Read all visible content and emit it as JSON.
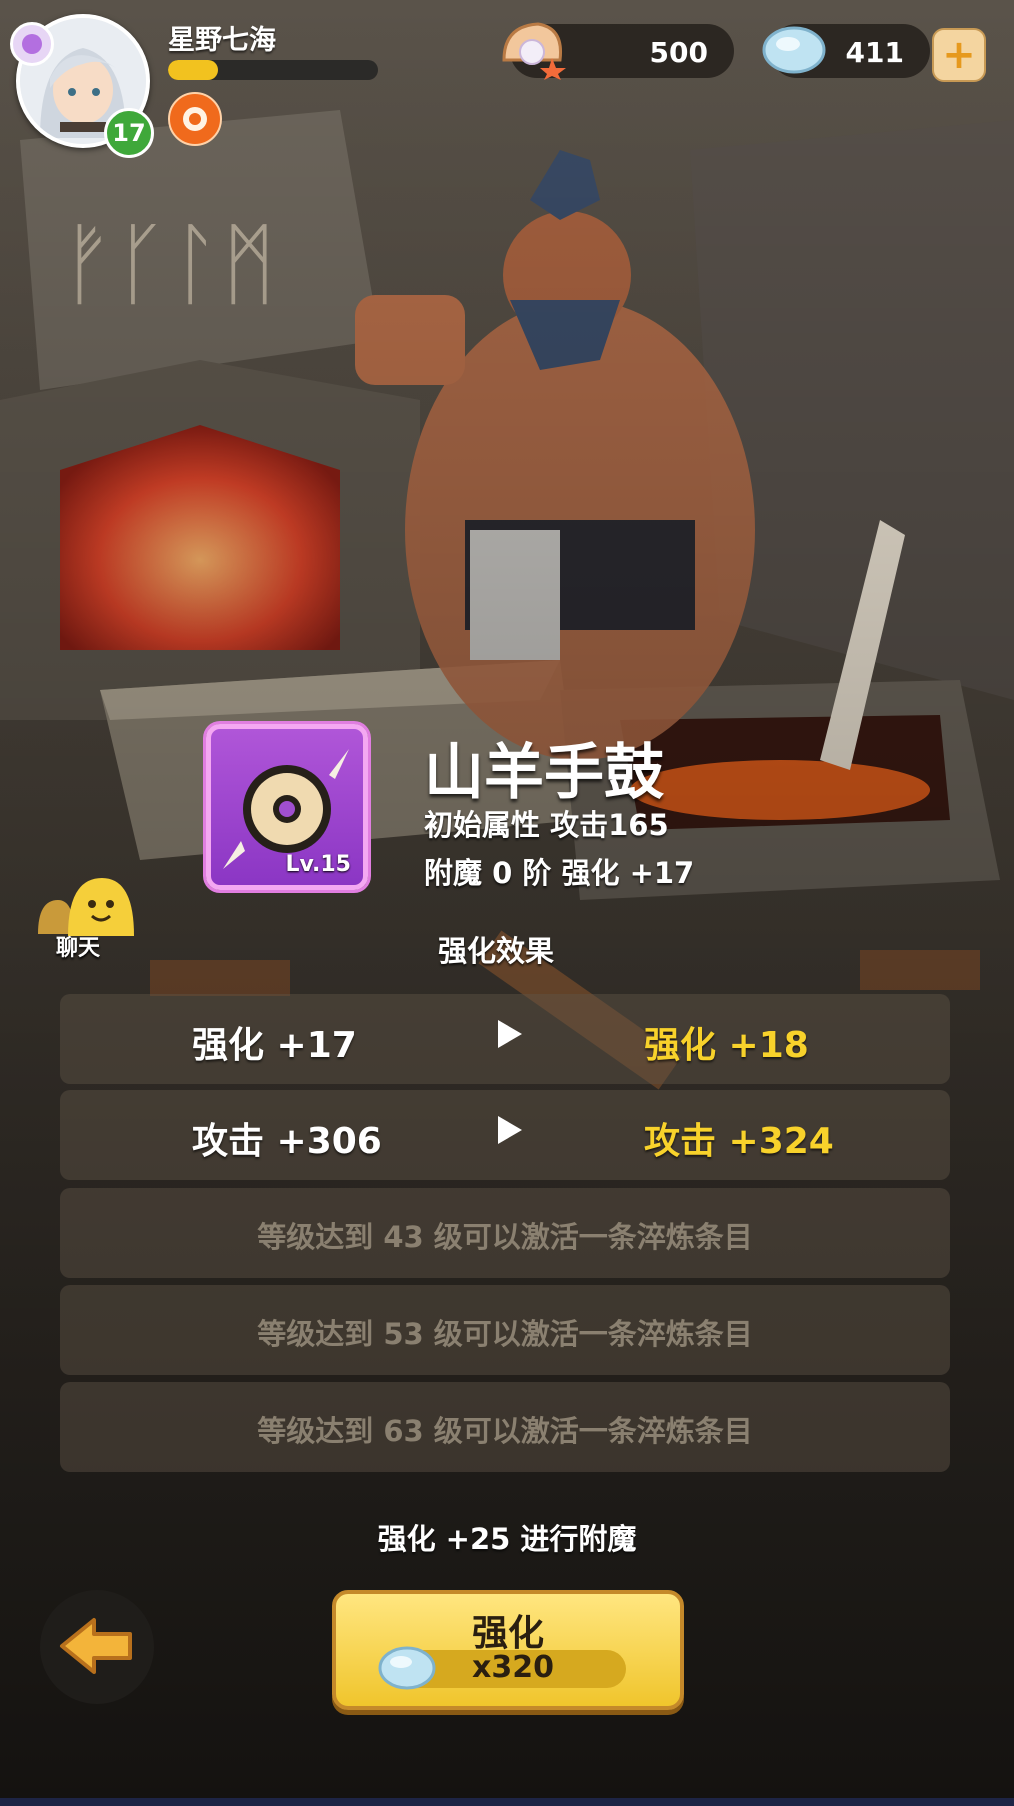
{
  "player": {
    "name": "星野七海",
    "level": "17",
    "xp_fraction": 0.24
  },
  "currencies": {
    "pearls": "500",
    "crystals": "411"
  },
  "item": {
    "name": "山羊手鼓",
    "level_label": "Lv.15",
    "base_stat": "初始属性  攻击165",
    "enchant_strength": "附魔 0 阶   强化 +17"
  },
  "effects": {
    "title": "强化效果",
    "rows": [
      {
        "current": "强化 +17",
        "next": "强化 +18"
      },
      {
        "current": "攻击  +306",
        "next": "攻击 +324"
      }
    ],
    "locked": [
      "等级达到 43 级可以激活一条淬炼条目",
      "等级达到 53 级可以激活一条淬炼条目",
      "等级达到 63 级可以激活一条淬炼条目"
    ]
  },
  "chat_label": "聊天",
  "enchant_note": "强化 +25 进行附魔",
  "action": {
    "label": "强化",
    "cost": "x320"
  },
  "colors": {
    "highlight": "#f8d22b",
    "item_rarity": "#b056d8",
    "level_badge": "#3fa83a"
  },
  "icons": {
    "currency_1": "pearl-shell-icon",
    "currency_2": "crystal-stone-icon",
    "add": "plus-icon",
    "back": "back-arrow-icon",
    "buff": "buff-badge-icon",
    "chat": "chat-bubble-icon"
  }
}
